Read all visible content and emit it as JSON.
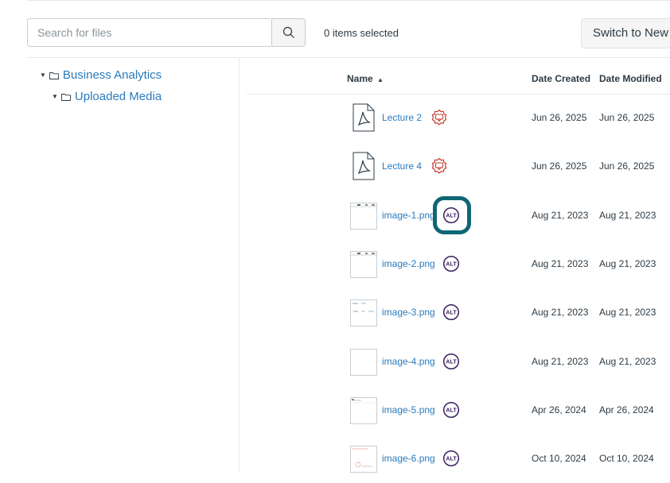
{
  "toolbar": {
    "search_placeholder": "Search for files",
    "search_icon": "search-icon",
    "selected_text": "0 items selected",
    "switch_label": "Switch to New"
  },
  "tree": [
    {
      "label": "Business Analytics",
      "icon": "folder-icon",
      "expanded": true
    },
    {
      "label": "Uploaded Media",
      "icon": "folder-icon",
      "expanded": true
    }
  ],
  "table": {
    "columns": {
      "name": "Name",
      "sort_indicator": "▲",
      "created": "Date Created",
      "modified": "Date Modified"
    },
    "rows": [
      {
        "name": "Lecture 2",
        "type": "pdf",
        "badge": "accessibility-issue-icon",
        "created": "Jun 26, 2025",
        "modified": "Jun 26, 2025"
      },
      {
        "name": "Lecture 4",
        "type": "pdf",
        "badge": "accessibility-issue-icon",
        "created": "Jun 26, 2025",
        "modified": "Jun 26, 2025"
      },
      {
        "name": "image-1.png",
        "type": "image",
        "badge": "alt-text-icon",
        "created": "Aug 21, 2023",
        "modified": "Aug 21, 2023"
      },
      {
        "name": "image-2.png",
        "type": "image",
        "badge": "alt-text-icon",
        "created": "Aug 21, 2023",
        "modified": "Aug 21, 2023"
      },
      {
        "name": "image-3.png",
        "type": "image",
        "badge": "alt-text-icon",
        "created": "Aug 21, 2023",
        "modified": "Aug 21, 2023"
      },
      {
        "name": "image-4.png",
        "type": "image",
        "badge": "alt-text-icon",
        "created": "Aug 21, 2023",
        "modified": "Aug 21, 2023"
      },
      {
        "name": "image-5.png",
        "type": "image",
        "badge": "alt-text-icon",
        "created": "Apr 26, 2024",
        "modified": "Apr 26, 2024"
      },
      {
        "name": "image-6.png",
        "type": "image",
        "badge": "alt-text-icon",
        "created": "Oct 10, 2024",
        "modified": "Oct 10, 2024"
      }
    ]
  },
  "colors": {
    "link": "#2b7abc",
    "focus": "#0f6674",
    "issue": "#c23c2d",
    "alt_badge": "#3b1f5e"
  }
}
